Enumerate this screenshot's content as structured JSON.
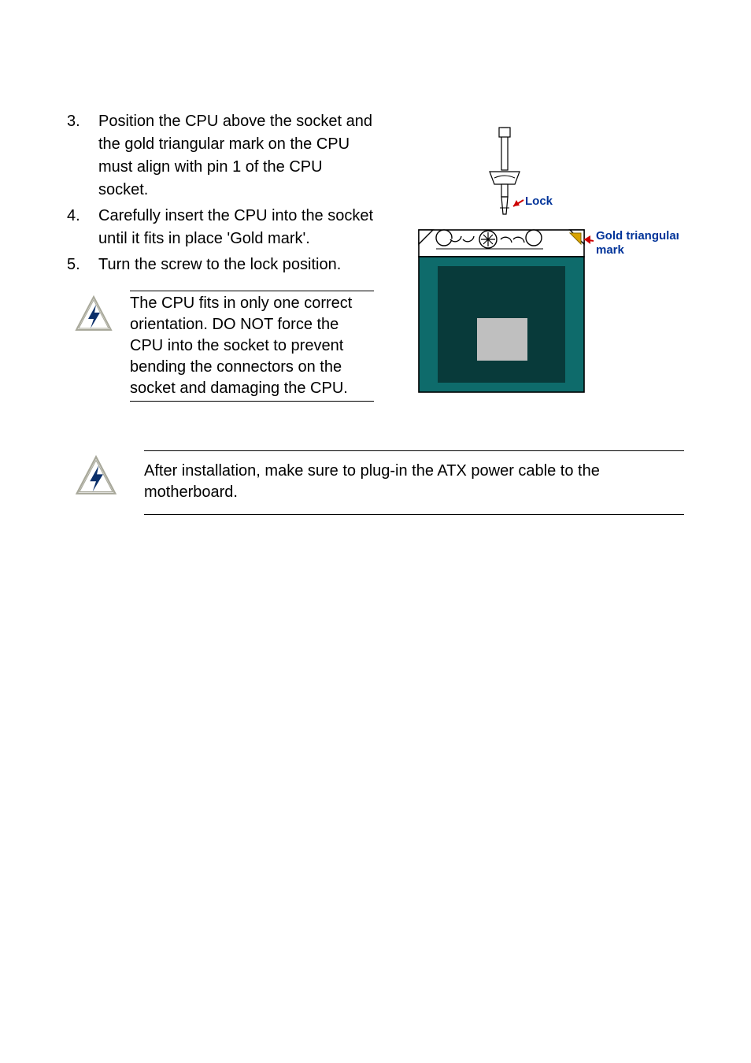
{
  "steps": [
    {
      "n": "3.",
      "text": "Position the CPU above the socket and the gold triangular mark on the CPU must align with pin 1 of the CPU socket."
    },
    {
      "n": "4.",
      "text": "Carefully insert the CPU into the socket until it fits in place 'Gold mark'."
    },
    {
      "n": "5.",
      "text": "Turn the screw to the lock position."
    }
  ],
  "callout1": "The CPU fits in only one correct orientation. DO NOT force the CPU into the socket to prevent bending the connectors on the socket and damaging the CPU.",
  "callout2": "After installation, make sure to plug-in the ATX power cable to the motherboard.",
  "diagram": {
    "label_lock": "Lock",
    "label_mark": "Gold triangular mark"
  },
  "icons": {
    "warning": "warning-bolt-icon"
  }
}
